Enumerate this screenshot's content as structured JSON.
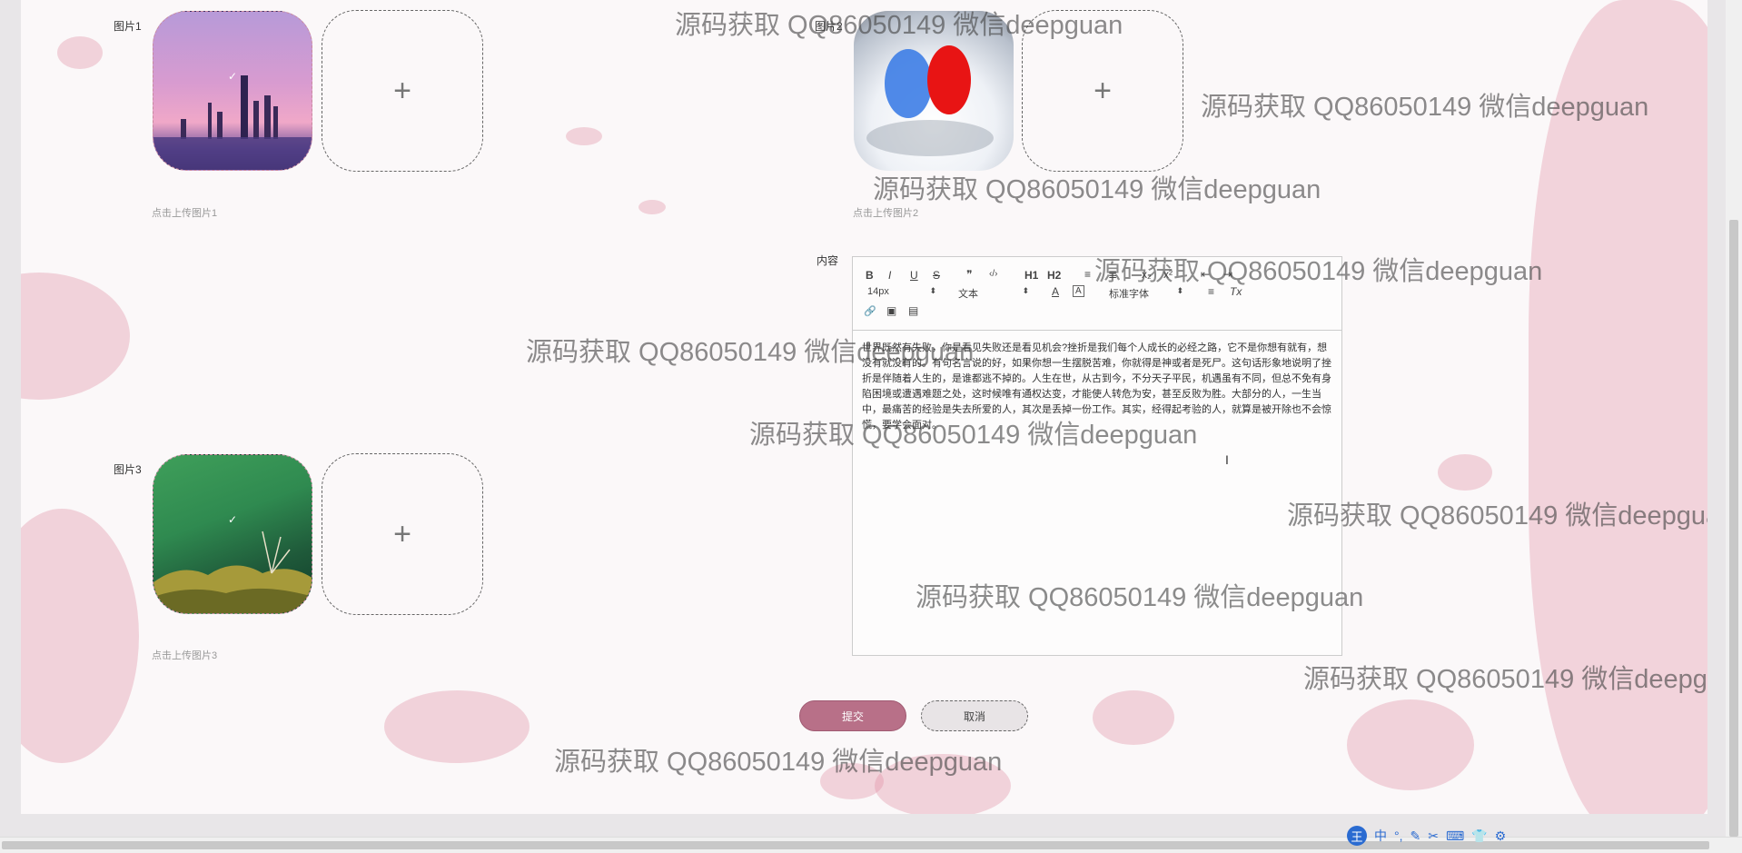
{
  "form": {
    "image1": {
      "label": "图片1",
      "hint": "点击上传图片1"
    },
    "image2": {
      "label": "图片2",
      "hint": "点击上传图片2"
    },
    "image3": {
      "label": "图片3",
      "hint": "点击上传图片3"
    },
    "upload_plus": "+",
    "content_label": "内容",
    "check_mark": "✓"
  },
  "editor": {
    "toolbar": {
      "bold": "B",
      "italic": "I",
      "underline": "U",
      "strike": "S",
      "quote": "❞",
      "code": "‹/›",
      "h1": "H1",
      "h2": "H2",
      "size": "14px",
      "type": "文本",
      "font": "标准字体",
      "font_color": "A",
      "bg_color": "A",
      "clear": "Tx",
      "link": "🔗",
      "image": "▣",
      "video": "▤"
    },
    "content": "世界既然有失败，你是看见失败还是看见机会?挫折是我们每个人成长的必经之路，它不是你想有就有，想没有就没有的。有句名言说的好，如果你想一生摆脱苦难，你就得是神或者是死尸。这句话形象地说明了挫折是伴随着人生的，是谁都逃不掉的。人生在世，从古到今，不分天子平民，机遇虽有不同，但总不免有身陷困境或遭遇难题之处，这时候唯有通权达变，才能使人转危为安，甚至反败为胜。大部分的人，一生当中，最痛苦的经验是失去所爱的人，其次是丢掉一份工作。其实，经得起考验的人，就算是被开除也不会惊慌，要学会面对。"
  },
  "buttons": {
    "submit": "提交",
    "cancel": "取消"
  },
  "watermark": "源码获取 QQ86050149 微信deepguan",
  "ime": {
    "logo": "王",
    "mode": "中",
    "punct": "°,",
    "pen": "✎",
    "cut": "✂",
    "kbd": "⌨",
    "skin": "👕",
    "gear": "⚙"
  },
  "colors": {
    "accent": "#b87088"
  }
}
